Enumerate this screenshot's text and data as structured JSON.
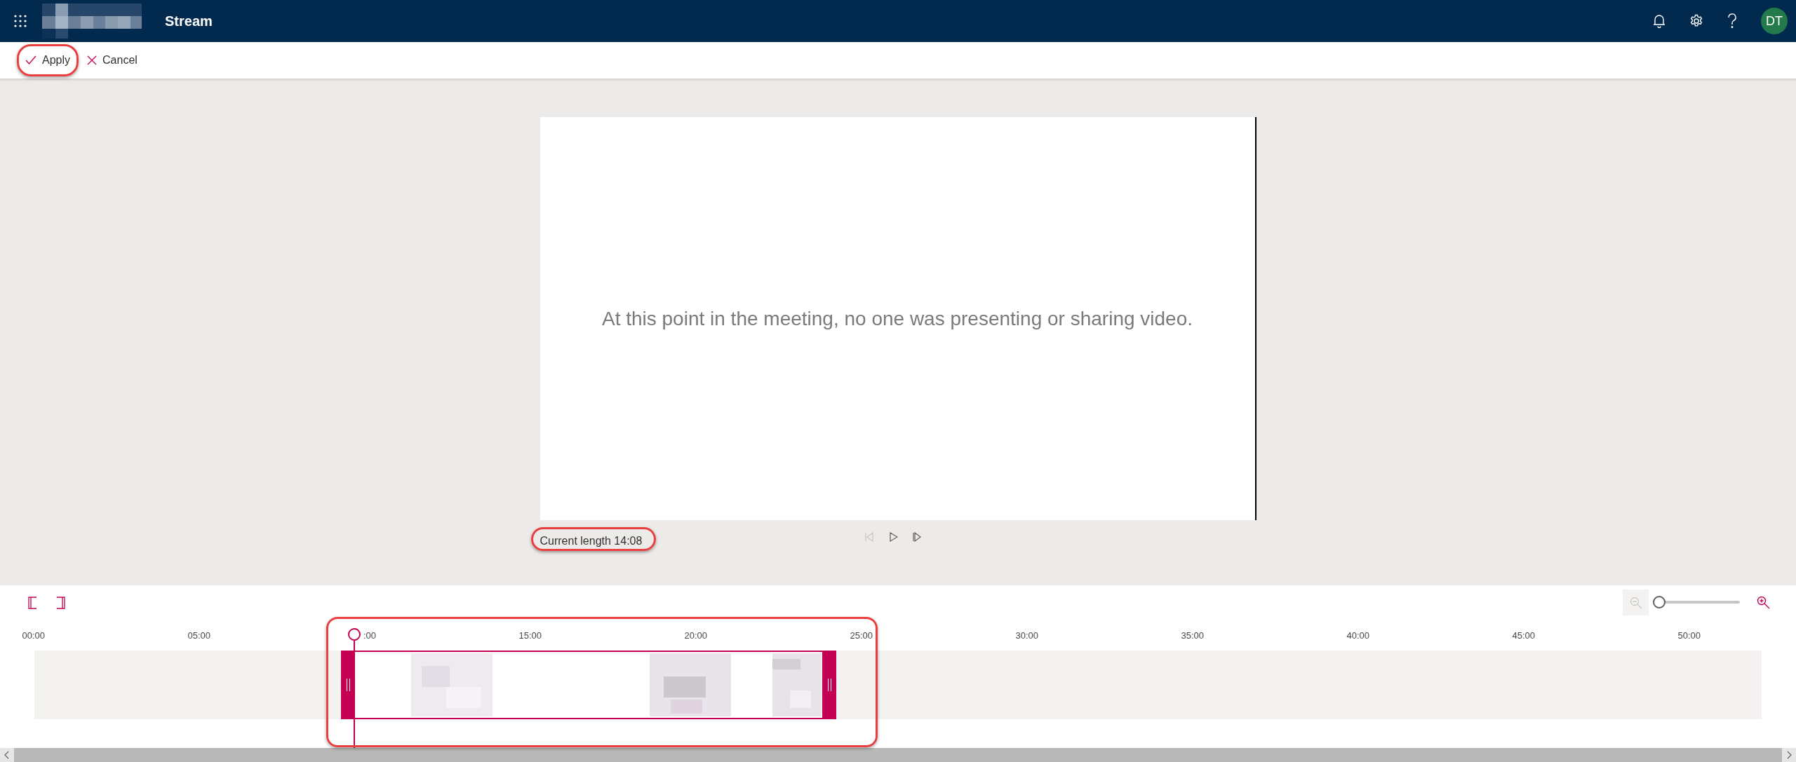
{
  "app_bar": {
    "title": "Stream",
    "avatar_initials": "DT"
  },
  "toolbar": {
    "buttons": [
      {
        "label": "Apply",
        "kind": "apply",
        "highlighted": true
      },
      {
        "label": "Cancel",
        "kind": "cancel",
        "highlighted": false
      }
    ]
  },
  "player": {
    "message": "At this point in the meeting, no one was presenting or sharing video.",
    "current_length": "Current length 14:08",
    "current_length_highlighted": true,
    "controls": [
      {
        "kind": "previous",
        "disabled": true
      },
      {
        "kind": "play",
        "disabled": false
      },
      {
        "kind": "next",
        "disabled": false
      }
    ]
  },
  "timeline": {
    "zoom": {
      "level": 0,
      "zoom_out_disabled": true
    },
    "ticks": [
      "00:00",
      "05:00",
      ":00",
      "15:00",
      "20:00",
      "25:00",
      "30:00",
      "35:00",
      "40:00",
      "45:00",
      "50:00"
    ],
    "selection_highlighted": true
  }
}
